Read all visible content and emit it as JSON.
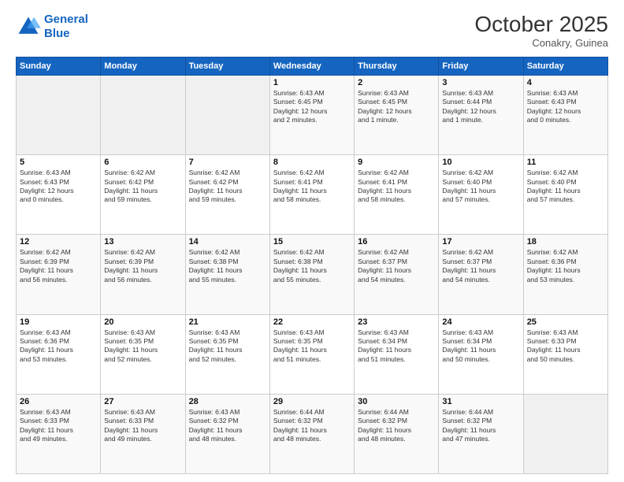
{
  "header": {
    "logo_line1": "General",
    "logo_line2": "Blue",
    "month": "October 2025",
    "location": "Conakry, Guinea"
  },
  "days_of_week": [
    "Sunday",
    "Monday",
    "Tuesday",
    "Wednesday",
    "Thursday",
    "Friday",
    "Saturday"
  ],
  "weeks": [
    [
      {
        "day": "",
        "info": ""
      },
      {
        "day": "",
        "info": ""
      },
      {
        "day": "",
        "info": ""
      },
      {
        "day": "1",
        "info": "Sunrise: 6:43 AM\nSunset: 6:45 PM\nDaylight: 12 hours\nand 2 minutes."
      },
      {
        "day": "2",
        "info": "Sunrise: 6:43 AM\nSunset: 6:45 PM\nDaylight: 12 hours\nand 1 minute."
      },
      {
        "day": "3",
        "info": "Sunrise: 6:43 AM\nSunset: 6:44 PM\nDaylight: 12 hours\nand 1 minute."
      },
      {
        "day": "4",
        "info": "Sunrise: 6:43 AM\nSunset: 6:43 PM\nDaylight: 12 hours\nand 0 minutes."
      }
    ],
    [
      {
        "day": "5",
        "info": "Sunrise: 6:43 AM\nSunset: 6:43 PM\nDaylight: 12 hours\nand 0 minutes."
      },
      {
        "day": "6",
        "info": "Sunrise: 6:42 AM\nSunset: 6:42 PM\nDaylight: 11 hours\nand 59 minutes."
      },
      {
        "day": "7",
        "info": "Sunrise: 6:42 AM\nSunset: 6:42 PM\nDaylight: 11 hours\nand 59 minutes."
      },
      {
        "day": "8",
        "info": "Sunrise: 6:42 AM\nSunset: 6:41 PM\nDaylight: 11 hours\nand 58 minutes."
      },
      {
        "day": "9",
        "info": "Sunrise: 6:42 AM\nSunset: 6:41 PM\nDaylight: 11 hours\nand 58 minutes."
      },
      {
        "day": "10",
        "info": "Sunrise: 6:42 AM\nSunset: 6:40 PM\nDaylight: 11 hours\nand 57 minutes."
      },
      {
        "day": "11",
        "info": "Sunrise: 6:42 AM\nSunset: 6:40 PM\nDaylight: 11 hours\nand 57 minutes."
      }
    ],
    [
      {
        "day": "12",
        "info": "Sunrise: 6:42 AM\nSunset: 6:39 PM\nDaylight: 11 hours\nand 56 minutes."
      },
      {
        "day": "13",
        "info": "Sunrise: 6:42 AM\nSunset: 6:39 PM\nDaylight: 11 hours\nand 56 minutes."
      },
      {
        "day": "14",
        "info": "Sunrise: 6:42 AM\nSunset: 6:38 PM\nDaylight: 11 hours\nand 55 minutes."
      },
      {
        "day": "15",
        "info": "Sunrise: 6:42 AM\nSunset: 6:38 PM\nDaylight: 11 hours\nand 55 minutes."
      },
      {
        "day": "16",
        "info": "Sunrise: 6:42 AM\nSunset: 6:37 PM\nDaylight: 11 hours\nand 54 minutes."
      },
      {
        "day": "17",
        "info": "Sunrise: 6:42 AM\nSunset: 6:37 PM\nDaylight: 11 hours\nand 54 minutes."
      },
      {
        "day": "18",
        "info": "Sunrise: 6:42 AM\nSunset: 6:36 PM\nDaylight: 11 hours\nand 53 minutes."
      }
    ],
    [
      {
        "day": "19",
        "info": "Sunrise: 6:43 AM\nSunset: 6:36 PM\nDaylight: 11 hours\nand 53 minutes."
      },
      {
        "day": "20",
        "info": "Sunrise: 6:43 AM\nSunset: 6:35 PM\nDaylight: 11 hours\nand 52 minutes."
      },
      {
        "day": "21",
        "info": "Sunrise: 6:43 AM\nSunset: 6:35 PM\nDaylight: 11 hours\nand 52 minutes."
      },
      {
        "day": "22",
        "info": "Sunrise: 6:43 AM\nSunset: 6:35 PM\nDaylight: 11 hours\nand 51 minutes."
      },
      {
        "day": "23",
        "info": "Sunrise: 6:43 AM\nSunset: 6:34 PM\nDaylight: 11 hours\nand 51 minutes."
      },
      {
        "day": "24",
        "info": "Sunrise: 6:43 AM\nSunset: 6:34 PM\nDaylight: 11 hours\nand 50 minutes."
      },
      {
        "day": "25",
        "info": "Sunrise: 6:43 AM\nSunset: 6:33 PM\nDaylight: 11 hours\nand 50 minutes."
      }
    ],
    [
      {
        "day": "26",
        "info": "Sunrise: 6:43 AM\nSunset: 6:33 PM\nDaylight: 11 hours\nand 49 minutes."
      },
      {
        "day": "27",
        "info": "Sunrise: 6:43 AM\nSunset: 6:33 PM\nDaylight: 11 hours\nand 49 minutes."
      },
      {
        "day": "28",
        "info": "Sunrise: 6:43 AM\nSunset: 6:32 PM\nDaylight: 11 hours\nand 48 minutes."
      },
      {
        "day": "29",
        "info": "Sunrise: 6:44 AM\nSunset: 6:32 PM\nDaylight: 11 hours\nand 48 minutes."
      },
      {
        "day": "30",
        "info": "Sunrise: 6:44 AM\nSunset: 6:32 PM\nDaylight: 11 hours\nand 48 minutes."
      },
      {
        "day": "31",
        "info": "Sunrise: 6:44 AM\nSunset: 6:32 PM\nDaylight: 11 hours\nand 47 minutes."
      },
      {
        "day": "",
        "info": ""
      }
    ]
  ]
}
